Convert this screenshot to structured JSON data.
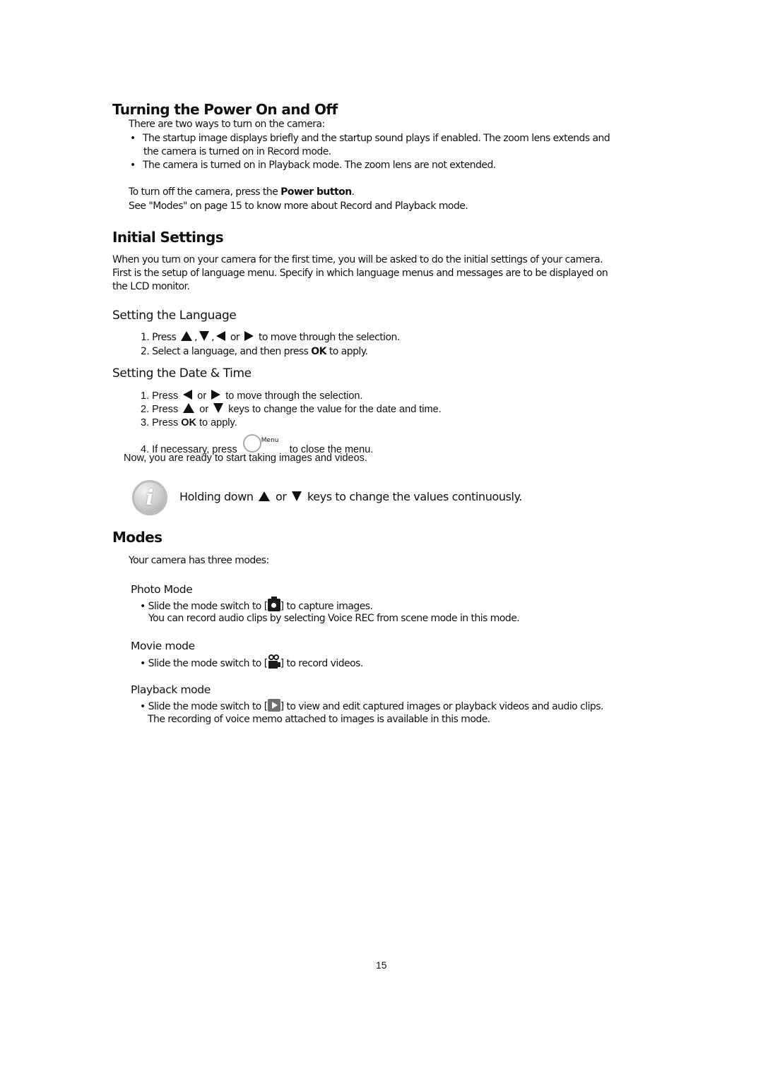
{
  "power": {
    "heading": "Turning the Power On and Off",
    "intro": "There are two ways to turn on the camera:",
    "bullets": [
      {
        "line1": "The startup image displays briefly and the startup sound plays if enabled. The zoom lens extends and",
        "line2": "the camera is turned on in Record mode."
      },
      {
        "line1": "The camera is turned on in Playback mode. The zoom lens are not extended."
      }
    ],
    "off_prefix": "To turn off the camera, press the ",
    "off_bold": "Power button",
    "off_suffix": ".",
    "see_modes": "See \"Modes\" on page 15 to know more about Record and Playback mode."
  },
  "initial": {
    "heading": "Initial Settings",
    "para_lines": [
      "When you turn on your camera for the first time, you will be asked to do the initial settings of your camera.",
      "First is the setup of language menu. Specify in which language menus and messages are to be displayed on",
      "the LCD monitor."
    ],
    "language": {
      "heading": "Setting the Language",
      "step1_num": "1.",
      "step1_prefix": "Press ",
      "step1_comma1": ",",
      "step1_comma2": ",",
      "step1_or": "or",
      "step1_suffix": "to move through the selection.",
      "step2_num": "2.",
      "step2_prefix": "Select a language, and then press ",
      "step2_bold": "OK",
      "step2_suffix": " to apply."
    },
    "datetime": {
      "heading": "Setting the Date & Time",
      "step1_num": "1.",
      "step1_prefix": "Press",
      "step1_or": "or",
      "step1_suffix": "to move through the selection.",
      "step2_num": "2.",
      "step2_prefix": "Press",
      "step2_or": "or",
      "step2_suffix": "keys to change the value for the date and time.",
      "step3_num": "3.",
      "step3_prefix": "Press ",
      "step3_bold": "OK",
      "step3_suffix": " to apply.",
      "step4_num": "4.",
      "step4_prefix": "If necessary, press",
      "step4_menu_label": "Menu",
      "step4_suffix": "to close the menu.",
      "ready": "Now, you are ready to start taking images and videos."
    },
    "note": {
      "prefix": "Holding down",
      "or": "or",
      "suffix": "keys to change the values continuously."
    }
  },
  "modes": {
    "heading": "Modes",
    "intro": "Your camera has three modes:",
    "photo": {
      "heading": "Photo Mode",
      "line1_prefix": "Slide the mode switch to [",
      "line1_suffix": "] to capture images.",
      "line2": "You can record audio clips by selecting Voice REC from scene mode in this mode."
    },
    "movie": {
      "heading": "Movie mode",
      "line1_prefix": "Slide the mode switch to [",
      "line1_suffix": "] to record videos."
    },
    "playback": {
      "heading": "Playback mode",
      "line1_prefix": "Slide the mode switch to [",
      "line1_suffix": "] to view and edit captured images or playback videos and audio clips.",
      "line2": "The recording of voice memo attached to images is available in this mode."
    }
  },
  "page_number": "15"
}
